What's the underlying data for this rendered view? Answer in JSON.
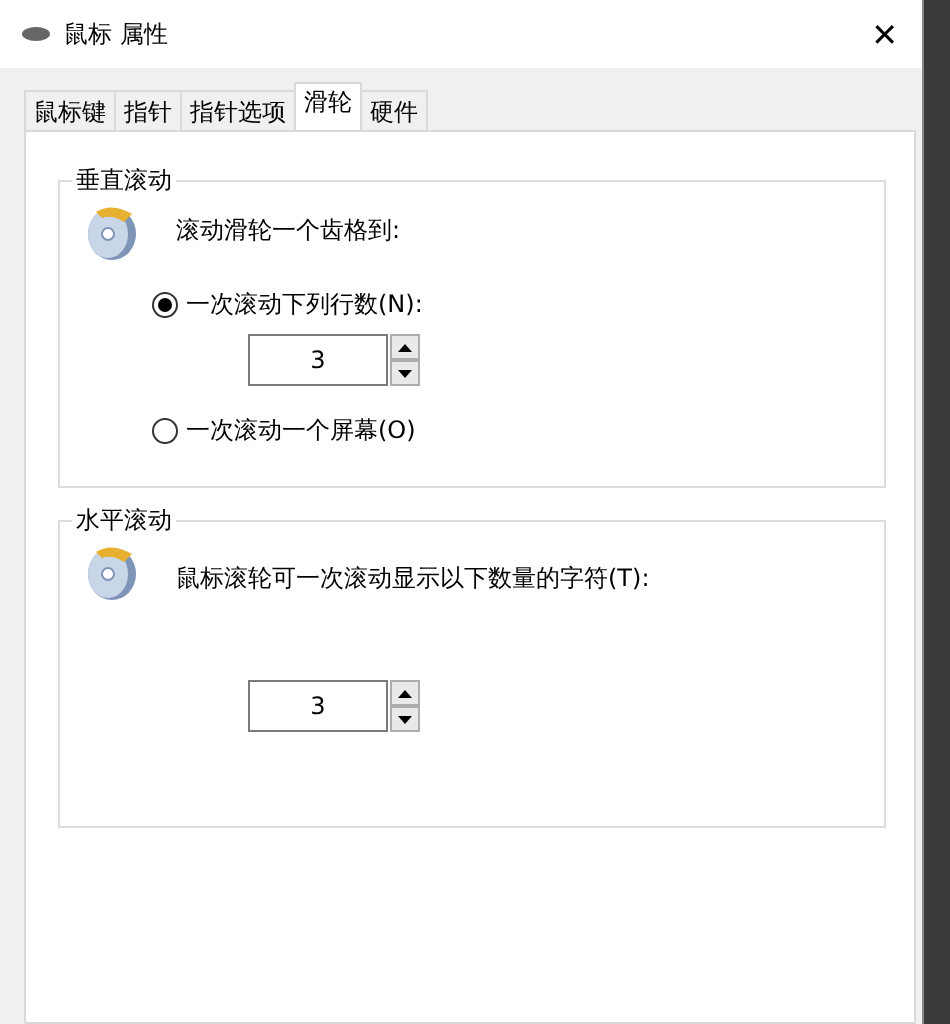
{
  "window": {
    "title": "鼠标 属性",
    "close": "✕"
  },
  "tabs": [
    {
      "label": "鼠标键",
      "selected": false
    },
    {
      "label": "指针",
      "selected": false
    },
    {
      "label": "指针选项",
      "selected": false
    },
    {
      "label": "滑轮",
      "selected": true
    },
    {
      "label": "硬件",
      "selected": false
    }
  ],
  "vertical_scrolling": {
    "title": "垂直滚动",
    "prompt": "滚动滑轮一个齿格到:",
    "options": [
      {
        "label": "一次滚动下列行数(N):",
        "selected": true,
        "spinner": {
          "value": "3"
        }
      },
      {
        "label": "一次滚动一个屏幕(O)",
        "selected": false
      }
    ]
  },
  "horizontal_scrolling": {
    "title": "水平滚动",
    "prompt": "鼠标滚轮可一次滚动显示以下数量的字符(T):",
    "spinner": {
      "value": "3"
    }
  }
}
